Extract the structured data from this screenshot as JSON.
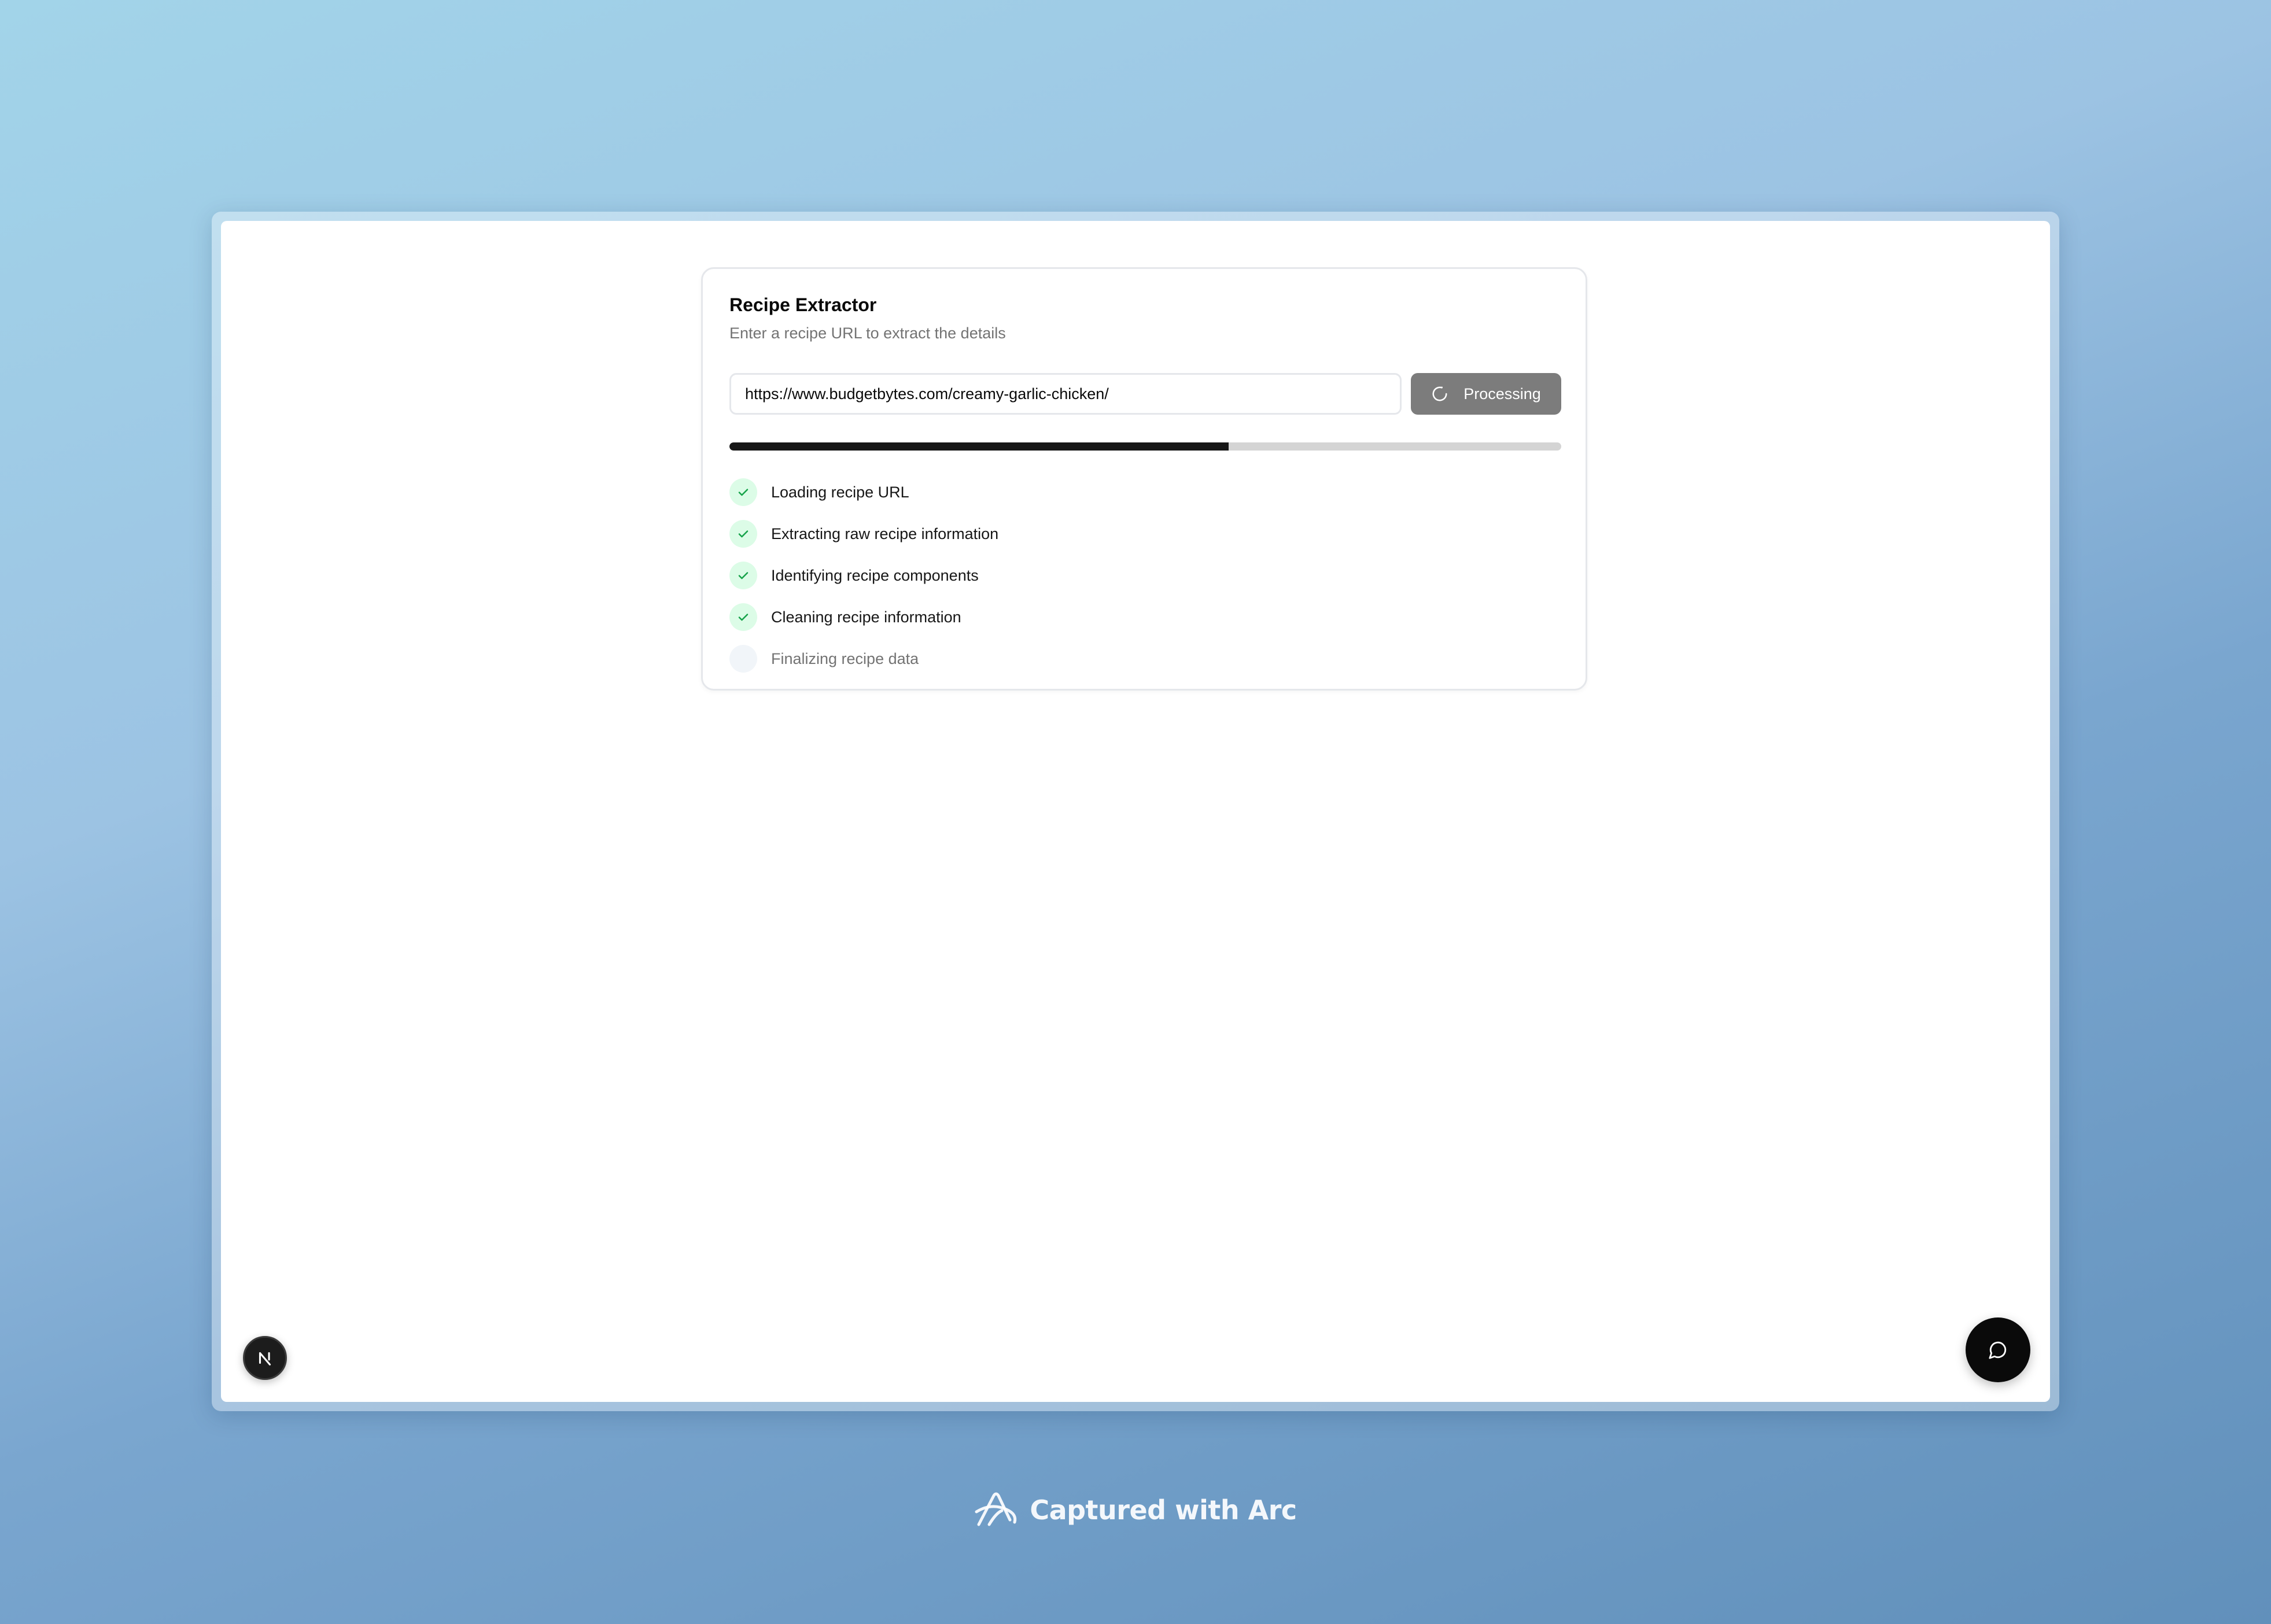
{
  "card": {
    "title": "Recipe Extractor",
    "subtitle": "Enter a recipe URL to extract the details"
  },
  "url_input": {
    "value": "https://www.budgetbytes.com/creamy-garlic-chicken/",
    "placeholder": ""
  },
  "process_button": {
    "label": "Processing",
    "icon": "spinner-icon"
  },
  "progress": {
    "percent": 60
  },
  "steps": [
    {
      "label": "Loading recipe URL",
      "status": "done",
      "icon": "check-icon"
    },
    {
      "label": "Extracting raw recipe information",
      "status": "done",
      "icon": "check-icon"
    },
    {
      "label": "Identifying recipe components",
      "status": "done",
      "icon": "check-icon"
    },
    {
      "label": "Cleaning recipe information",
      "status": "done",
      "icon": "check-icon"
    },
    {
      "label": "Finalizing recipe data",
      "status": "pending",
      "icon": "empty-circle-icon"
    }
  ],
  "badge": {
    "letter": "N"
  },
  "chat_button": {
    "icon": "chat-bubble-icon"
  },
  "watermark": {
    "text": "Captured with Arc",
    "icon": "arc-logo-icon"
  },
  "colors": {
    "accent_dark": "#171717",
    "check_green": "#16a34a",
    "check_bg": "#dcfce7",
    "button_processing": "#7c7c7c"
  }
}
